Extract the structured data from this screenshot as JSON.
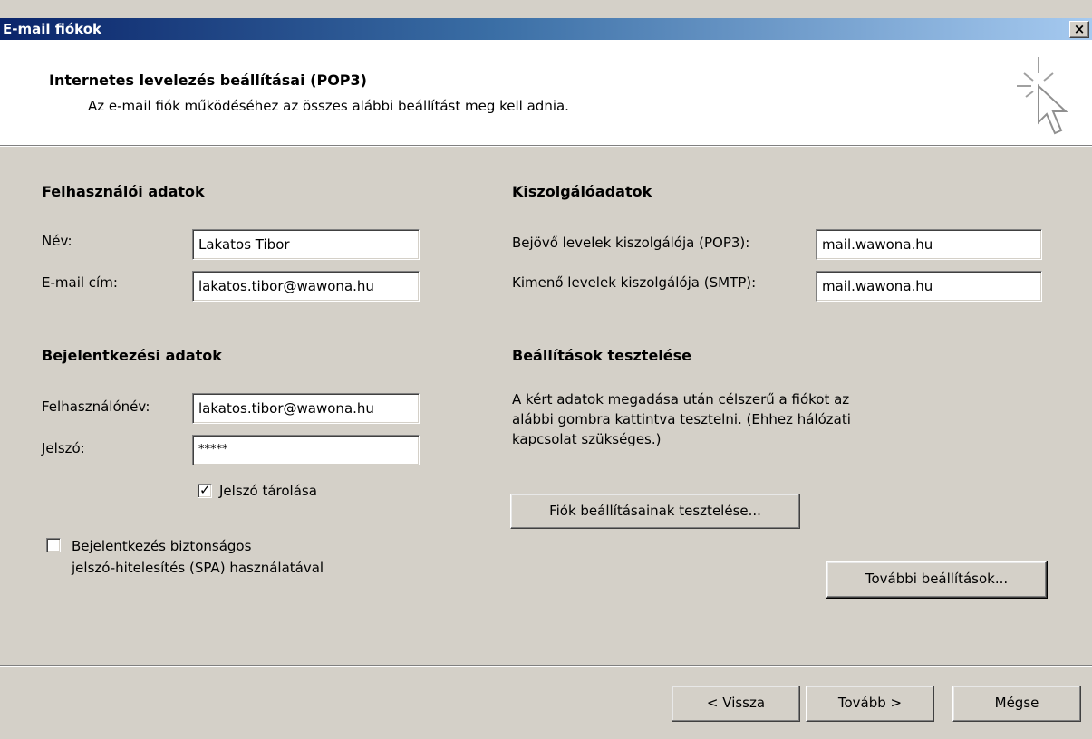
{
  "window": {
    "title": "E-mail fiókok",
    "close_label": "×"
  },
  "header": {
    "title": "Internetes levelezés beállításai (POP3)",
    "subtitle": "Az e-mail fiók működéséhez az összes alábbi beállítást meg kell adnia.",
    "icon": "cursor-sparkle-icon"
  },
  "user_info": {
    "heading": "Felhasználói adatok",
    "name_label": "Név:",
    "name_value": "Lakatos Tibor",
    "email_label": "E-mail cím:",
    "email_value": "lakatos.tibor@wawona.hu"
  },
  "server_info": {
    "heading": "Kiszolgálóadatok",
    "incoming_label": "Bejövő levelek kiszolgálója (POP3):",
    "incoming_value": "mail.wawona.hu",
    "outgoing_label": "Kimenő levelek kiszolgálója (SMTP):",
    "outgoing_value": "mail.wawona.hu"
  },
  "logon_info": {
    "heading": "Bejelentkezési adatok",
    "username_label": "Felhasználónév:",
    "username_value": "lakatos.tibor@wawona.hu",
    "password_label": "Jelszó:",
    "password_value": "*****",
    "remember_label": "Jelszó tárolása",
    "remember_checked": true,
    "spa_label_line1": "Bejelentkezés biztonságos",
    "spa_label_line2": "jelszó-hitelesítés (SPA) használatával",
    "spa_checked": false
  },
  "test_settings": {
    "heading": "Beállítások tesztelése",
    "text_line1": "A kért adatok megadása után célszerű a fiókot az",
    "text_line2": "alábbi gombra kattintva tesztelni. (Ehhez hálózati",
    "text_line3": "kapcsolat szükséges.)",
    "test_button": "Fiók beállításainak tesztelése...",
    "more_button": "További beállítások..."
  },
  "footer": {
    "back_button": "< Vissza",
    "next_button": "Tovább >",
    "cancel_button": "Mégse"
  }
}
